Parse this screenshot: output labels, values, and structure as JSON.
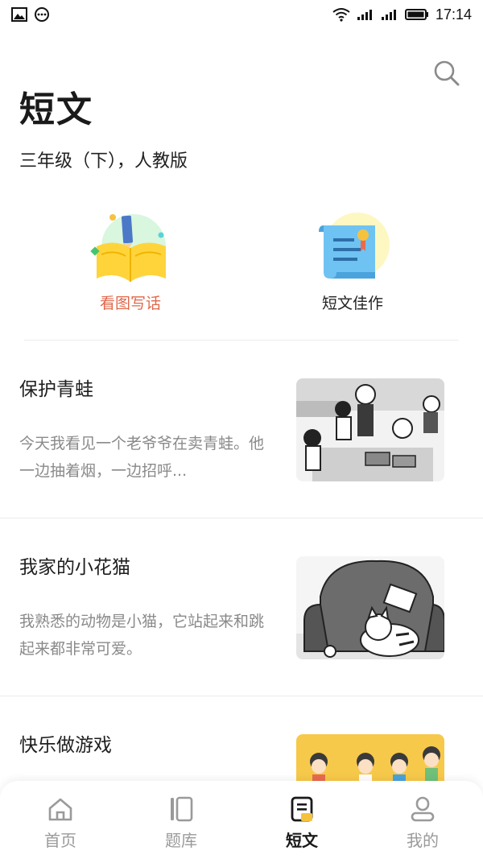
{
  "status_bar": {
    "time": "17:14"
  },
  "header": {
    "title": "短文",
    "grade": "三年级（下），人教版"
  },
  "categories": [
    {
      "label": "看图写话",
      "icon": "book-pencil-icon",
      "color": "#e0674a"
    },
    {
      "label": "短文佳作",
      "icon": "scroll-medal-icon",
      "color": "#222222"
    }
  ],
  "articles": [
    {
      "title": "保护青蛙",
      "excerpt": "今天我看见一个老爷爷在卖青蛙。他一边抽着烟，一边招呼..."
    },
    {
      "title": "我家的小花猫",
      "excerpt": "我熟悉的动物是小猫，它站起来和跳起来都非常可爱。"
    },
    {
      "title": "快乐做游戏",
      "excerpt": ""
    }
  ],
  "bottom_nav": {
    "items": [
      {
        "label": "首页",
        "icon": "home-icon"
      },
      {
        "label": "题库",
        "icon": "question-bank-icon"
      },
      {
        "label": "短文",
        "icon": "essay-icon"
      },
      {
        "label": "我的",
        "icon": "profile-icon"
      }
    ],
    "active_index": 2
  },
  "colors": {
    "accent": "#e0674a",
    "active_nav": "#1a1a1a",
    "inactive_nav": "#9a9a9a",
    "excerpt": "#8a8a8a"
  }
}
